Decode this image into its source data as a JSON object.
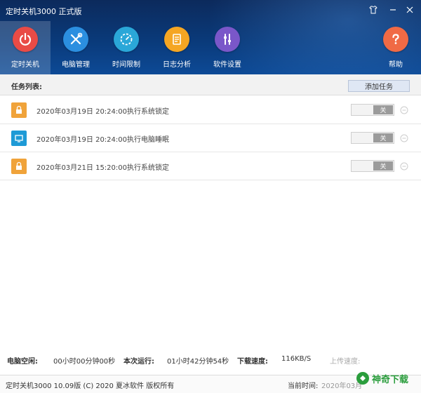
{
  "window": {
    "title": "定时关机3000 正式版"
  },
  "nav": {
    "items": [
      {
        "label": "定时关机",
        "icon": "power-icon",
        "color": "#e94b46",
        "active": true
      },
      {
        "label": "电脑管理",
        "icon": "tools-icon",
        "color": "#2b8fe0"
      },
      {
        "label": "时间限制",
        "icon": "timer-icon",
        "color": "#2aa7d8"
      },
      {
        "label": "日志分析",
        "icon": "log-icon",
        "color": "#f5a623"
      },
      {
        "label": "软件设置",
        "icon": "settings-icon",
        "color": "#7a57c9"
      }
    ],
    "help_label": "帮助",
    "help_color": "#f06a45"
  },
  "tasks": {
    "header": "任务列表:",
    "add_label": "添加任务",
    "rows": [
      {
        "text": "2020年03月19日 20:24:00执行系统锁定",
        "icon": "lock-icon",
        "color": "#f0a33a",
        "toggle": "关"
      },
      {
        "text": "2020年03月19日 20:24:00执行电脑睡眠",
        "icon": "monitor-icon",
        "color": "#1e9ad6",
        "toggle": "关"
      },
      {
        "text": "2020年03月21日 15:20:00执行系统锁定",
        "icon": "lock-icon",
        "color": "#f0a33a",
        "toggle": "关"
      }
    ]
  },
  "stats": {
    "idle_label": "电脑空闲:",
    "idle_value": "00小时00分钟00秒",
    "run_label": "本次运行:",
    "run_value": "01小时42分钟54秒",
    "down_label": "下载速度:",
    "down_value": "116KB/S",
    "up_label": "上传速度:"
  },
  "footer": {
    "version": "定时关机3000 10.09版 (C) 2020  夏冰软件 版权所有",
    "time_label": "当前时间:",
    "time_value": "2020年03月"
  },
  "watermark": {
    "text": "神奇下载"
  }
}
